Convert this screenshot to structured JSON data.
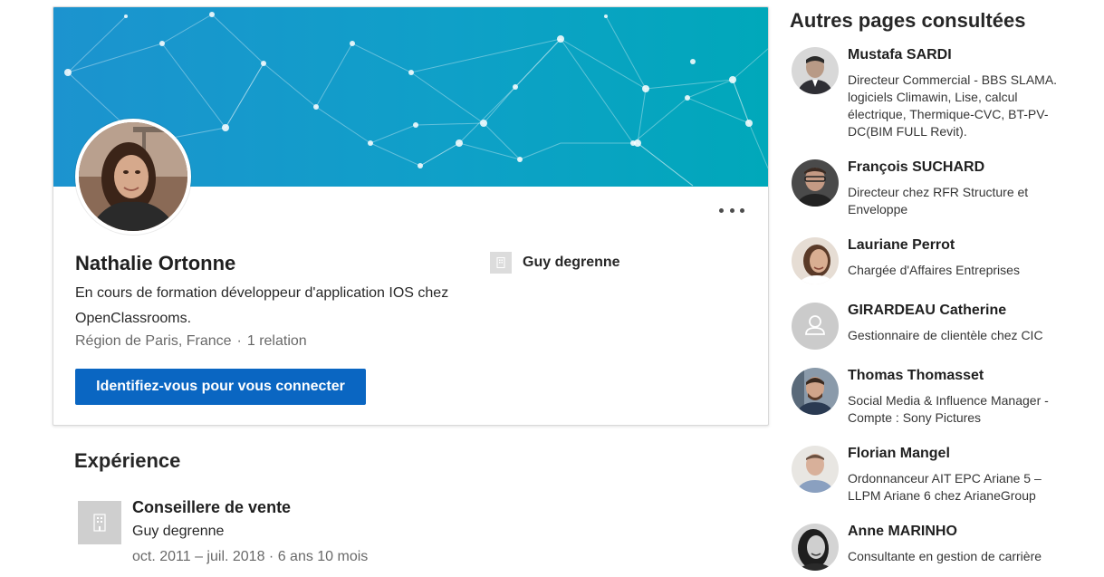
{
  "profile": {
    "name": "Nathalie Ortonne",
    "headline": "En cours de formation développeur d'application IOS chez OpenClassrooms.",
    "location": "Région de Paris, France",
    "separator": "·",
    "relations": "1 relation",
    "connect_label": "Identifiez-vous pour vous connecter",
    "current_company": "Guy degrenne"
  },
  "experience": {
    "title": "Expérience",
    "items": [
      {
        "role": "Conseillere de vente",
        "company": "Guy degrenne",
        "dates": "oct. 2011 – juil. 2018 · 6 ans 10 mois"
      }
    ]
  },
  "sidebar": {
    "title": "Autres pages consultées",
    "people": [
      {
        "name": "Mustafa SARDI",
        "description": "Directeur Commercial - BBS SLAMA. logiciels Climawin, Lise, calcul électrique, Thermique-CVC, BT-PV-DC(BIM FULL Revit).",
        "avatar_tone": "#8a8a8a"
      },
      {
        "name": "François SUCHARD",
        "description": "Directeur chez RFR Structure et Enveloppe",
        "avatar_tone": "#5a5a5a"
      },
      {
        "name": "Lauriane Perrot",
        "description": "Chargée d'Affaires Entreprises",
        "avatar_tone": "#c9a68a"
      },
      {
        "name": "GIRARDEAU Catherine",
        "description": "Gestionnaire de clientèle chez CIC",
        "avatar_tone": "#c6c6c6"
      },
      {
        "name": "Thomas Thomasset",
        "description": "Social Media & Influence Manager - Compte : Sony Pictures",
        "avatar_tone": "#6d7d8e"
      },
      {
        "name": "Florian Mangel",
        "description": "Ordonnanceur AIT EPC Ariane 5 – LLPM Ariane 6 chez ArianeGroup",
        "avatar_tone": "#b7b0a8"
      },
      {
        "name": "Anne MARINHO",
        "description": "Consultante en gestion de carrière",
        "avatar_tone": "#3a3a3a"
      }
    ]
  },
  "colors": {
    "accent": "#0a66c2",
    "banner_start": "#1a9bd0",
    "banner_end": "#00a3b4"
  }
}
